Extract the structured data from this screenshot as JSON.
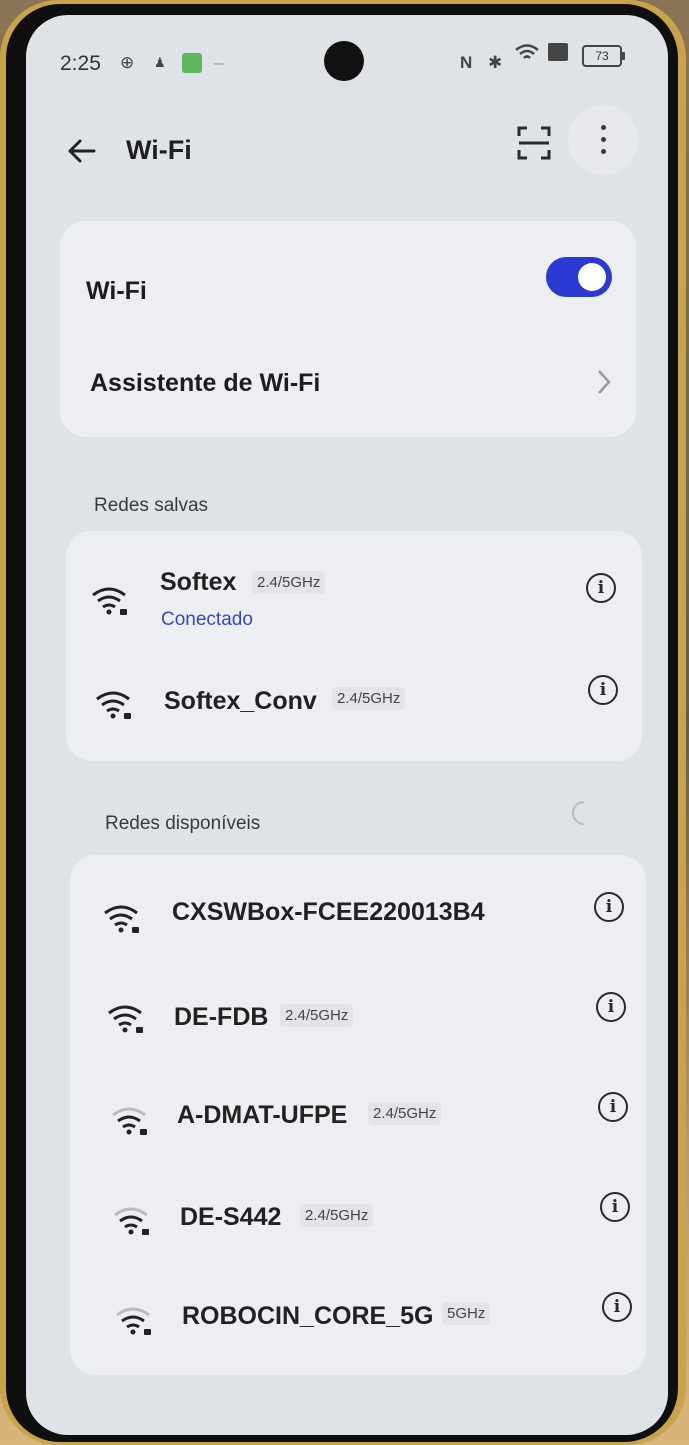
{
  "status_bar": {
    "time": "2:25",
    "icons": [
      "nfc-icon",
      "bluetooth-icon",
      "wifi-icon",
      "sim-icon"
    ],
    "battery": "73"
  },
  "header": {
    "title": "Wi-Fi",
    "icons": [
      "back-arrow-icon",
      "qr-scan-icon",
      "more-vert-icon"
    ]
  },
  "wifi_toggle": {
    "label": "Wi-Fi",
    "on": true,
    "accent": "#2b3ad1"
  },
  "assistant": {
    "label": "Assistente de Wi-Fi"
  },
  "saved": {
    "title": "Redes salvas",
    "networks": [
      {
        "name": "Softex",
        "band": "2.4/5GHz",
        "status": "Conectado"
      },
      {
        "name": "Softex_Conv",
        "band": "2.4/5GHz"
      }
    ]
  },
  "available": {
    "title": "Redes disponíveis",
    "networks": [
      {
        "name": "CXSWBox-FCEE220013B4"
      },
      {
        "name": "DE-FDB",
        "band": "2.4/5GHz"
      },
      {
        "name": "A-DMAT-UFPE",
        "band": "2.4/5GHz"
      },
      {
        "name": "DE-S442",
        "band": "2.4/5GHz"
      },
      {
        "name": "ROBOCIN_CORE_5G",
        "band": "5GHz"
      }
    ]
  }
}
